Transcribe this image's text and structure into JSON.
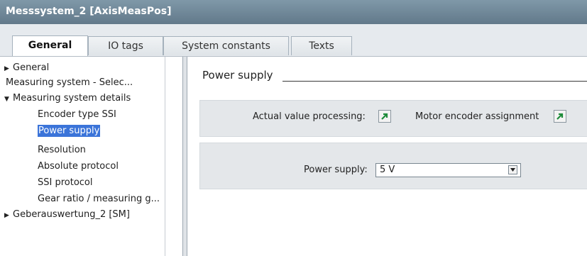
{
  "window": {
    "title": "Messsystem_2 [AxisMeasPos]"
  },
  "tabs": [
    {
      "label": "General",
      "active": true
    },
    {
      "label": "IO tags",
      "active": false
    },
    {
      "label": "System constants",
      "active": false
    },
    {
      "label": "Texts",
      "active": false
    }
  ],
  "nav": {
    "items": [
      {
        "label": "General",
        "expander": "collapsed"
      },
      {
        "label": "Measuring system - Selec..."
      },
      {
        "label": "Measuring system details",
        "expander": "expanded"
      },
      {
        "label": "Encoder type SSI"
      },
      {
        "label": "Power supply",
        "selected": true
      },
      {
        "label": "Resolution"
      },
      {
        "label": "Absolute protocol"
      },
      {
        "label": "SSI protocol"
      },
      {
        "label": "Gear ratio / measuring g..."
      },
      {
        "label": "Geberauswertung_2 [SM]",
        "expander": "collapsed"
      }
    ]
  },
  "content": {
    "section_title": "Power supply",
    "actual_value_label": "Actual value processing:",
    "motor_encoder_label": "Motor encoder assignment",
    "power_supply_label": "Power supply:",
    "power_supply_value": "5 V"
  },
  "colors": {
    "accent": "#3b74d9",
    "titlebar": "#6e8696",
    "link_arrow": "#1e8c3a"
  },
  "icons": {
    "link": "goto-arrow-icon",
    "dropdown": "chevron-down-icon",
    "expand": "triangle-right-icon",
    "collapse": "triangle-down-icon"
  }
}
